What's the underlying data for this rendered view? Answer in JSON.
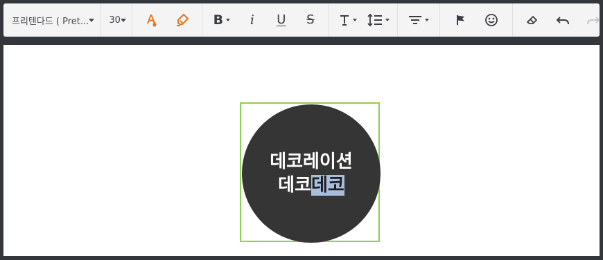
{
  "toolbar": {
    "font_family": "프리텐다드 ( Pret...",
    "font_size": "30",
    "icons": {
      "font_color": "font-color-icon",
      "highlight": "highlighter-icon",
      "bold": "bold-icon",
      "italic": "italic-icon",
      "underline": "underline-icon",
      "strikethrough": "strikethrough-icon",
      "text_style": "text-style-icon",
      "line_height": "line-height-icon",
      "align": "align-icon",
      "flag": "flag-icon",
      "emoji": "smiley-icon",
      "eraser": "eraser-icon",
      "undo": "undo-icon",
      "redo": "redo-icon"
    },
    "bold_glyph": "B",
    "italic_glyph": "i",
    "underline_glyph": "U",
    "strike_glyph": "S",
    "accent_color": "#e8711c",
    "disabled_color": "#c5c7cc"
  },
  "canvas": {
    "text_line1": "데코레이션",
    "text_line2_plain": "데코",
    "text_line2_selected": "데코",
    "circle_color": "#353535",
    "selection_border_color": "#8cd14f",
    "text_selection_color": "#a8bedc"
  }
}
